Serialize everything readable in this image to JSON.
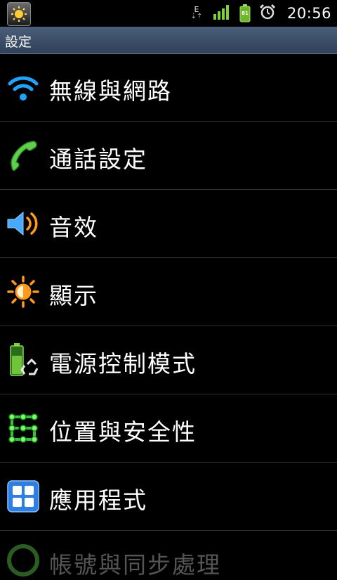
{
  "status_bar": {
    "network_type": "E",
    "battery_level": "81",
    "time": "20:56",
    "icons": [
      "app-notification-icon",
      "data-transfer-icon",
      "signal-strength-icon",
      "battery-icon",
      "alarm-icon"
    ]
  },
  "title_bar": {
    "title": "設定"
  },
  "settings": {
    "items": [
      {
        "label": "無線與網路",
        "icon": "wifi-icon"
      },
      {
        "label": "通話設定",
        "icon": "phone-icon"
      },
      {
        "label": "音效",
        "icon": "speaker-icon"
      },
      {
        "label": "顯示",
        "icon": "brightness-icon"
      },
      {
        "label": "電源控制模式",
        "icon": "power-saving-icon"
      },
      {
        "label": "位置與安全性",
        "icon": "location-security-icon"
      },
      {
        "label": "應用程式",
        "icon": "applications-icon"
      },
      {
        "label": "帳號與同步處理",
        "icon": "accounts-sync-icon"
      }
    ]
  },
  "colors": {
    "title_bar": "#3b4e67",
    "divider": "#333333",
    "wifi_blue": "#1ea3ff",
    "phone_green": "#5fcf4c",
    "accent_orange": "#ff9a1a"
  }
}
